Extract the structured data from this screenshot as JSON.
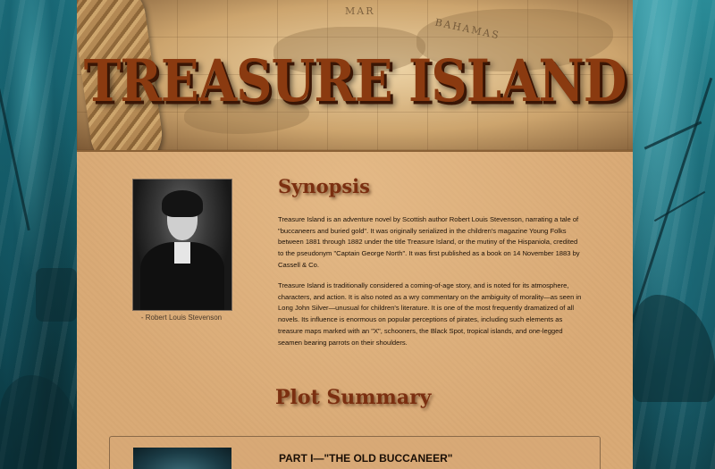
{
  "header": {
    "title": "TREASURE ISLAND",
    "map_labels": [
      "MAR",
      "BAHAMAS"
    ]
  },
  "synopsis": {
    "heading": "Synopsis",
    "portrait_caption": "- Robert Louis Stevenson",
    "paragraphs": [
      "Treasure Island is an adventure novel by Scottish author Robert Louis Stevenson, narrating a tale of \"buccaneers and buried gold\". It was originally serialized in the children's magazine Young Folks between 1881 through 1882 under the title Treasure Island, or the mutiny of the Hispaniola, credited to the pseudonym \"Captain George North\". It was first published as a book on 14 November 1883 by Cassell & Co.",
      "Treasure Island is traditionally considered a coming-of-age story, and is noted for its atmosphere, characters, and action. It is also noted as a wry commentary on the ambiguity of morality—as seen in Long John Silver—unusual for children's literature. It is one of the most frequently dramatized of all novels. Its influence is enormous on popular perceptions of pirates, including such elements as treasure maps marked with an \"X\", schooners, the Black Spot, tropical islands, and one-legged seamen bearing parrots on their shoulders."
    ]
  },
  "plot": {
    "heading": "Plot Summary",
    "parts": [
      {
        "title": "PART I—\"THE OLD BUCCANEER\""
      }
    ]
  },
  "colors": {
    "title": "#8a3a10",
    "heading": "#7b2f10",
    "paper": "#d9aa76",
    "sea": "#1c6f7c"
  }
}
